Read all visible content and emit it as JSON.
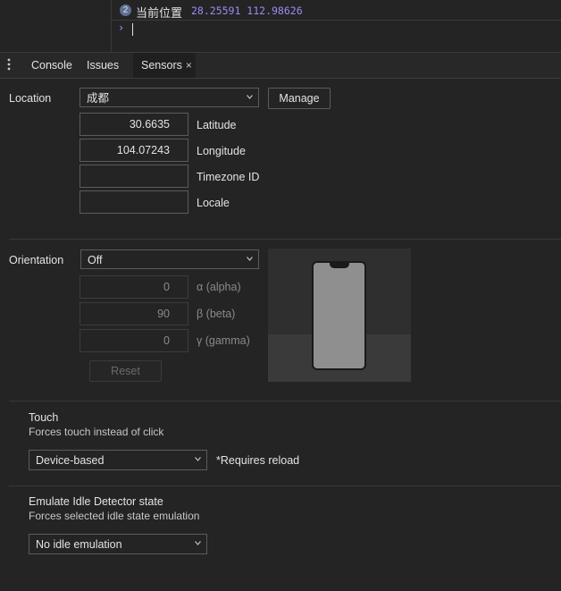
{
  "console": {
    "badge_count": "2",
    "log_label": "当前位置",
    "log_values": "28.25591 112.98626",
    "prompt_symbol": "›"
  },
  "tabs": [
    {
      "label": "Console"
    },
    {
      "label": "Issues"
    },
    {
      "label": "Sensors"
    }
  ],
  "tab_close_glyph": "×",
  "location": {
    "label": "Location",
    "selected": "成都",
    "manage_label": "Manage",
    "latitude_value": "30.6635",
    "latitude_label": "Latitude",
    "longitude_value": "104.07243",
    "longitude_label": "Longitude",
    "timezone_value": "",
    "timezone_label": "Timezone ID",
    "locale_value": "",
    "locale_label": "Locale"
  },
  "orientation": {
    "label": "Orientation",
    "selected": "Off",
    "alpha_value": "0",
    "alpha_label": "α (alpha)",
    "beta_value": "90",
    "beta_label": "β (beta)",
    "gamma_value": "0",
    "gamma_label": "γ (gamma)",
    "reset_label": "Reset"
  },
  "touch": {
    "title": "Touch",
    "description": "Forces touch instead of click",
    "selected": "Device-based",
    "note": "*Requires reload"
  },
  "idle": {
    "title": "Emulate Idle Detector state",
    "description": "Forces selected idle state emulation",
    "selected": "No idle emulation"
  },
  "colors": {
    "background": "#242424",
    "accent_blue": "#7cacf8",
    "log_value_purple": "#9b8cf2"
  }
}
